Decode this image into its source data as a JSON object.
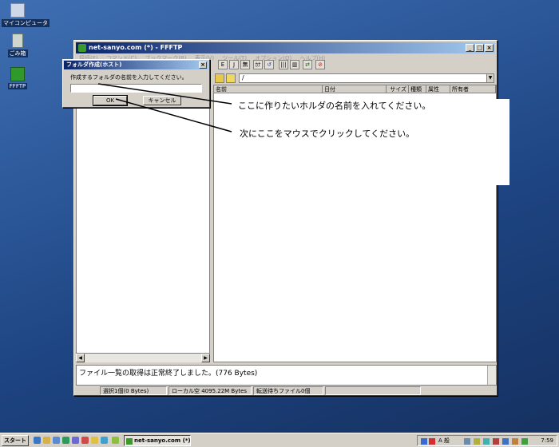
{
  "desktop": {
    "icons": [
      {
        "label": "マイコンピュータ"
      },
      {
        "label": "ごみ箱"
      },
      {
        "label": "FFFTP"
      }
    ]
  },
  "window": {
    "title": "net-sanyo.com (*) - FFFTP",
    "menu": [
      "接続(F)",
      "コマンド(C)",
      "ブックマーク(B)",
      "表示(V)",
      "ツール(T)",
      "オプション(O)",
      "ヘルプ(H)"
    ],
    "toolbar": {
      "e_label": "E",
      "j_label": "J",
      "mu_label": "無",
      "kana_label": "ｶﾅ"
    },
    "remote_path": "/",
    "columns": [
      "名前",
      "日付",
      "サイズ",
      "種類",
      "属性",
      "所有者"
    ],
    "log_text": "ファイル一覧の取得は正常終了しました。(776 Bytes)",
    "status": {
      "selection": "選択1個(0 Bytes)",
      "local_free": "ローカル空 4095.22M Bytes",
      "queue": "転送待ちファイル0個"
    }
  },
  "dialog": {
    "title": "フォルダ作成(ホスト)",
    "prompt": "作成するフォルダの名前を入力してください。",
    "input_value": "",
    "ok_label": "OK",
    "cancel_label": "キャンセル"
  },
  "annotations": {
    "note1": "ここに作りたいホルダの名前を入れてください。",
    "note2": "次にここをマウスでクリックしてください。"
  },
  "taskbar": {
    "start_label": "スタート",
    "task_item": "net-sanyo.com (*) -...",
    "ime": "A 般",
    "clock": "7:59"
  }
}
